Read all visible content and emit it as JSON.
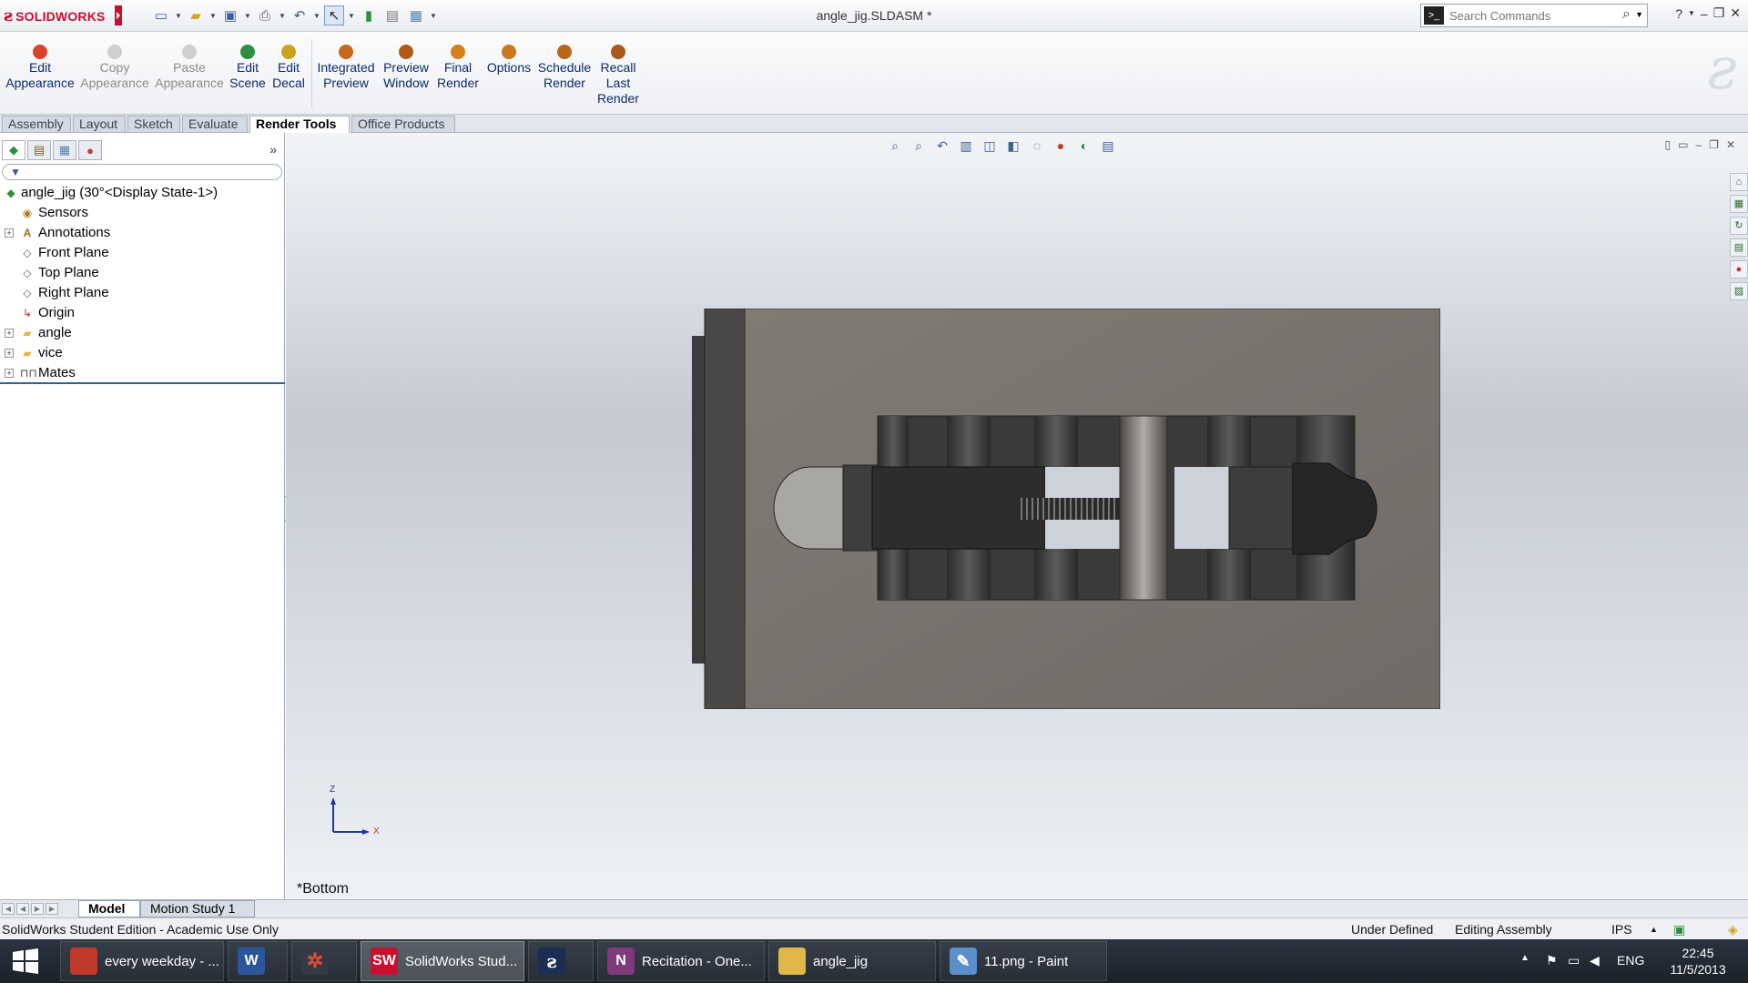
{
  "app": {
    "logo_text": "SOLIDWORKS",
    "document_title": "angle_jig.SLDASM *",
    "search": {
      "placeholder": "Search Commands"
    },
    "help_label": "?"
  },
  "ribbon": {
    "buttons": [
      {
        "label_1": "Edit",
        "label_2": "Appearance",
        "label_3": "",
        "color": "#d9452b",
        "enabled": true
      },
      {
        "label_1": "Copy",
        "label_2": "Appearance",
        "label_3": "",
        "color": "#9a9a9a",
        "enabled": false
      },
      {
        "label_1": "Paste",
        "label_2": "Appearance",
        "label_3": "",
        "color": "#9a9a9a",
        "enabled": false
      },
      {
        "label_1": "Edit",
        "label_2": "Scene",
        "label_3": "",
        "color": "#2f8f3e",
        "enabled": true
      },
      {
        "label_1": "Edit",
        "label_2": "Decal",
        "label_3": "",
        "color": "#c9a21e",
        "enabled": true
      },
      {
        "label_1": "Integrated",
        "label_2": "Preview",
        "label_3": "",
        "color": "#c56a1a",
        "enabled": true
      },
      {
        "label_1": "Preview",
        "label_2": "Window",
        "label_3": "",
        "color": "#b35a12",
        "enabled": true
      },
      {
        "label_1": "Final",
        "label_2": "Render",
        "label_3": "",
        "color": "#d4811c",
        "enabled": true
      },
      {
        "label_1": "Options",
        "label_2": "",
        "label_3": "",
        "color": "#c9781f",
        "enabled": true
      },
      {
        "label_1": "Schedule",
        "label_2": "Render",
        "label_3": "",
        "color": "#b8661a",
        "enabled": true
      },
      {
        "label_1": "Recall",
        "label_2": "Last",
        "label_3": "Render",
        "color": "#a85a1a",
        "enabled": true
      }
    ]
  },
  "tabs": [
    {
      "label": "Assembly",
      "active": false
    },
    {
      "label": "Layout",
      "active": false
    },
    {
      "label": "Sketch",
      "active": false
    },
    {
      "label": "Evaluate",
      "active": false
    },
    {
      "label": "Render Tools",
      "active": true
    },
    {
      "label": "Office Products",
      "active": false
    }
  ],
  "feature_tree": {
    "root": "angle_jig  (30°<Display State-1>)",
    "items": [
      {
        "label": "Sensors",
        "icon": "sensors-icon",
        "expandable": false
      },
      {
        "label": "Annotations",
        "icon": "annotations-icon",
        "expandable": true
      },
      {
        "label": "Front Plane",
        "icon": "plane-icon",
        "expandable": false
      },
      {
        "label": "Top Plane",
        "icon": "plane-icon",
        "expandable": false
      },
      {
        "label": "Right Plane",
        "icon": "plane-icon",
        "expandable": false
      },
      {
        "label": "Origin",
        "icon": "origin-icon",
        "expandable": false
      },
      {
        "label": "angle",
        "icon": "folder-icon",
        "expandable": true
      },
      {
        "label": "vice",
        "icon": "folder-icon",
        "expandable": true
      },
      {
        "label": "Mates",
        "icon": "mates-icon",
        "expandable": true
      }
    ]
  },
  "viewport": {
    "view_label": "*Bottom",
    "triad": {
      "z": "Z",
      "x": "X"
    }
  },
  "bottom_tabs": [
    {
      "label": "Model",
      "active": true
    },
    {
      "label": "Motion Study 1",
      "active": false
    }
  ],
  "status": {
    "edition": "SolidWorks Student Edition - Academic Use Only",
    "state": "Under Defined",
    "mode": "Editing Assembly",
    "units": "IPS"
  },
  "taskbar": {
    "items": [
      {
        "label": "every weekday - ...",
        "icon": "firefox-icon",
        "color": "#c0392b",
        "glyph": "",
        "active": false
      },
      {
        "label": "",
        "icon": "word-icon",
        "color": "#2b579a",
        "glyph": "W",
        "active": false
      },
      {
        "label": "",
        "icon": "solidworks-launcher-icon",
        "color": "#333a45",
        "glyph": "",
        "active": false
      },
      {
        "label": "SolidWorks Stud...",
        "icon": "solidworks-icon",
        "color": "#c8102e",
        "glyph": "SW",
        "active": true
      },
      {
        "label": "",
        "icon": "ds-app-icon",
        "color": "#1b2e52",
        "glyph": "",
        "active": false
      },
      {
        "label": "Recitation - One...",
        "icon": "onenote-icon",
        "color": "#80397b",
        "glyph": "N",
        "active": false
      },
      {
        "label": "angle_jig",
        "icon": "folder-icon",
        "color": "#e0b84a",
        "glyph": "",
        "active": false
      },
      {
        "label": "11.png - Paint",
        "icon": "paint-icon",
        "color": "#5b8fc9",
        "glyph": "",
        "active": false
      }
    ],
    "language": "ENG",
    "time": "22:45",
    "date": "11/5/2013"
  }
}
